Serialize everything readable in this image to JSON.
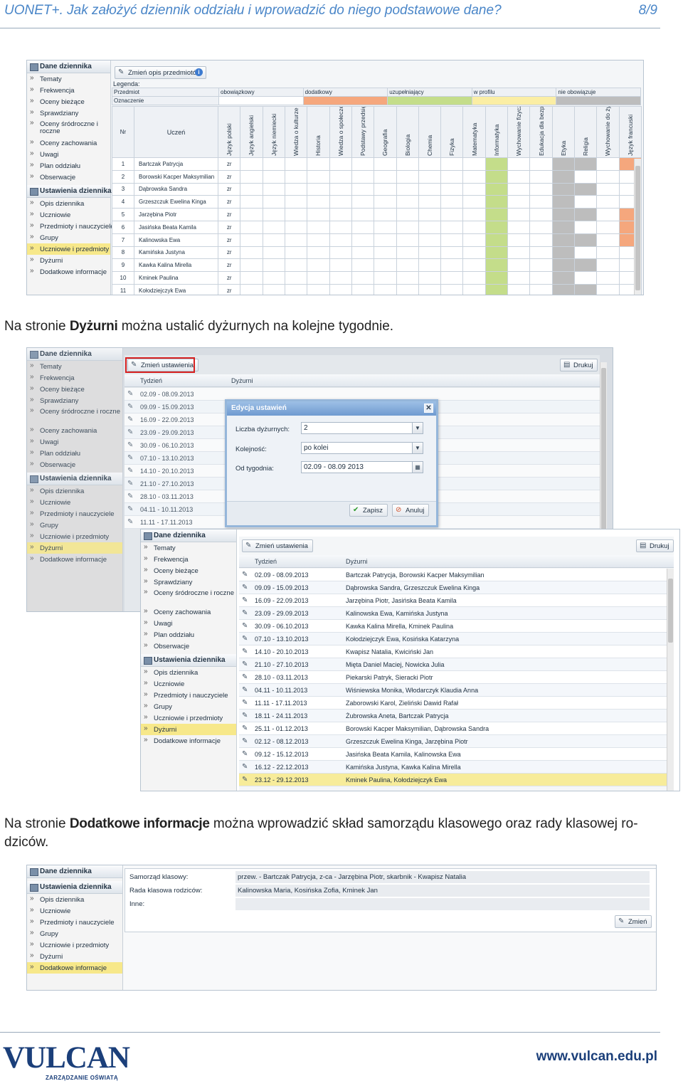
{
  "header": {
    "title": "UONET+. Jak założyć dziennik oddziału i wprowadzić do niego podstawowe dane?",
    "page": "8/9"
  },
  "sidebar1": {
    "sec1": "Dane dziennika",
    "items1": [
      "Tematy",
      "Frekwencja",
      "Oceny bieżące",
      "Sprawdziany",
      "Oceny śródroczne i roczne",
      "Oceny zachowania",
      "Uwagi",
      "Plan oddziału",
      "Obserwacje"
    ],
    "sec2": "Ustawienia dziennika",
    "items2": [
      "Opis dziennika",
      "Uczniowie",
      "Przedmioty i nauczyciele",
      "Grupy",
      "Uczniowie i przedmioty",
      "Dyżurni",
      "Dodatkowe informacje"
    ]
  },
  "shot1": {
    "change_button": "Zmień opis przedmiotów",
    "legend_label": "Legenda:",
    "legend_subject": "Przedmiot",
    "legend_marking": "Oznaczenie",
    "legend": [
      {
        "label": "obowiązkowy",
        "color": "#ffffff"
      },
      {
        "label": "dodatkowy",
        "color": "#f5a77d"
      },
      {
        "label": "uzupełniający",
        "color": "#c4dd8a"
      },
      {
        "label": "w profilu",
        "color": "#fbeea4"
      },
      {
        "label": "nie obowiązuje",
        "color": "#bdbdbd"
      }
    ],
    "col_nr": "Nr",
    "col_student": "Uczeń",
    "subjects": [
      "Język polski",
      "Język angielski",
      "Język niemiecki",
      "Wiedza o kulturze",
      "Historia",
      "Wiedza o społeczeństwie",
      "Podstawy przedsiębiorczości",
      "Geografia",
      "Biologia",
      "Chemia",
      "Fizyka",
      "Matematyka",
      "Informatyka",
      "Wychowanie fizyczne",
      "Edukacja dla bezpieczeństwa",
      "Etyka",
      "Religia",
      "Wychowanie do życia",
      "Język francuski"
    ],
    "students": [
      {
        "nr": "1",
        "name": "Bartczak Patrycja",
        "mark": "zr"
      },
      {
        "nr": "2",
        "name": "Borowski Kacper Maksymilian",
        "mark": "zr"
      },
      {
        "nr": "3",
        "name": "Dąbrowska Sandra",
        "mark": "zr"
      },
      {
        "nr": "4",
        "name": "Grzeszczuk Ewelina Kinga",
        "mark": "zr"
      },
      {
        "nr": "5",
        "name": "Jarzębina Piotr",
        "mark": "zr"
      },
      {
        "nr": "6",
        "name": "Jasińska Beata Kamila",
        "mark": "zr"
      },
      {
        "nr": "7",
        "name": "Kalinowska Ewa",
        "mark": "zr"
      },
      {
        "nr": "8",
        "name": "Kamińska Justyna",
        "mark": "zr"
      },
      {
        "nr": "9",
        "name": "Kawka Kalina Mirella",
        "mark": "zr"
      },
      {
        "nr": "10",
        "name": "Kminek Paulina",
        "mark": "zr"
      },
      {
        "nr": "11",
        "name": "Kołodziejczyk Ewa",
        "mark": "zr"
      }
    ]
  },
  "para1": {
    "before": "Na stronie ",
    "bold": "Dyżurni",
    "after": " można ustalić dyżurnych na kolejne tygodnie."
  },
  "shot2": {
    "change_button": "Zmień ustawienia",
    "print_button": "Drukuj",
    "col_week": "Tydzień",
    "col_duty": "Dyżurni",
    "weeks_back": [
      "02.09 - 08.09.2013",
      "09.09 - 15.09.2013",
      "16.09 - 22.09.2013",
      "23.09 - 29.09.2013",
      "30.09 - 06.10.2013",
      "07.10 - 13.10.2013",
      "14.10 - 20.10.2013",
      "21.10 - 27.10.2013",
      "28.10 - 03.11.2013",
      "04.11 - 10.11.2013",
      "11.11 - 17.11.2013"
    ],
    "dialog": {
      "title": "Edycja ustawień",
      "count_label": "Liczba dyżurnych:",
      "count_value": "2",
      "order_label": "Kolejność:",
      "order_value": "po kolei",
      "from_label": "Od tygodnia:",
      "from_value": "02.09 - 08.09 2013",
      "save": "Zapisz",
      "cancel": "Anuluj"
    },
    "rows": [
      {
        "week": "02.09 - 08.09.2013",
        "duty": "Bartczak Patrycja, Borowski Kacper Maksymilian"
      },
      {
        "week": "09.09 - 15.09.2013",
        "duty": "Dąbrowska Sandra, Grzeszczuk Ewelina Kinga"
      },
      {
        "week": "16.09 - 22.09.2013",
        "duty": "Jarzębina Piotr, Jasińska Beata Kamila"
      },
      {
        "week": "23.09 - 29.09.2013",
        "duty": "Kalinowska Ewa, Kamińska Justyna"
      },
      {
        "week": "30.09 - 06.10.2013",
        "duty": "Kawka Kalina Mirella, Kminek Paulina"
      },
      {
        "week": "07.10 - 13.10.2013",
        "duty": "Kołodziejczyk Ewa, Kosińska Katarzyna"
      },
      {
        "week": "14.10 - 20.10.2013",
        "duty": "Kwapisz Natalia, Kwiciński Jan"
      },
      {
        "week": "21.10 - 27.10.2013",
        "duty": "Mięta Daniel Maciej, Nowicka Julia"
      },
      {
        "week": "28.10 - 03.11.2013",
        "duty": "Piekarski Patryk, Sieracki Piotr"
      },
      {
        "week": "04.11 - 10.11.2013",
        "duty": "Wiśniewska Monika, Włodarczyk Klaudia Anna"
      },
      {
        "week": "11.11 - 17.11.2013",
        "duty": "Zaborowski Karol, Zieliński Dawid Rafał"
      },
      {
        "week": "18.11 - 24.11.2013",
        "duty": "Żubrowska Aneta, Bartczak Patrycja"
      },
      {
        "week": "25.11 - 01.12.2013",
        "duty": "Borowski Kacper Maksymilian, Dąbrowska Sandra"
      },
      {
        "week": "02.12 - 08.12.2013",
        "duty": "Grzeszczuk Ewelina Kinga, Jarzębina Piotr"
      },
      {
        "week": "09.12 - 15.12.2013",
        "duty": "Jasińska Beata Kamila, Kalinowska Ewa"
      },
      {
        "week": "16.12 - 22.12.2013",
        "duty": "Kamińska Justyna, Kawka Kalina Mirella"
      },
      {
        "week": "23.12 - 29.12.2013",
        "duty": "Kminek Paulina, Kołodziejczyk Ewa"
      }
    ]
  },
  "para2": {
    "before": "Na stronie ",
    "bold": "Dodatkowe informacje",
    "after": " można wprowadzić skład samorządu klasowego oraz rady klasowej ro-",
    "line2": "dziców."
  },
  "shot3": {
    "sec1": "Dane dziennika",
    "sec2": "Ustawienia dziennika",
    "items": [
      "Opis dziennika",
      "Uczniowie",
      "Przedmioty i nauczyciele",
      "Grupy",
      "Uczniowie i przedmioty",
      "Dyżurni",
      "Dodatkowe informacje"
    ],
    "label1": "Samorząd klasowy:",
    "label2": "Rada klasowa rodziców:",
    "label3": "Inne:",
    "value1": "przew. - Bartczak Patrycja, z-ca - Jarzębina Piotr, skarbnik - Kwapisz Natalia",
    "value2": "Kalinowska Maria, Kosińska Zofia, Kminek Jan",
    "value3": "",
    "change_button": "Zmień"
  },
  "footer": {
    "logo": "VULCAN",
    "logo_sub": "ZARZĄDZANIE OŚWIATĄ",
    "url": "www.vulcan.edu.pl"
  }
}
